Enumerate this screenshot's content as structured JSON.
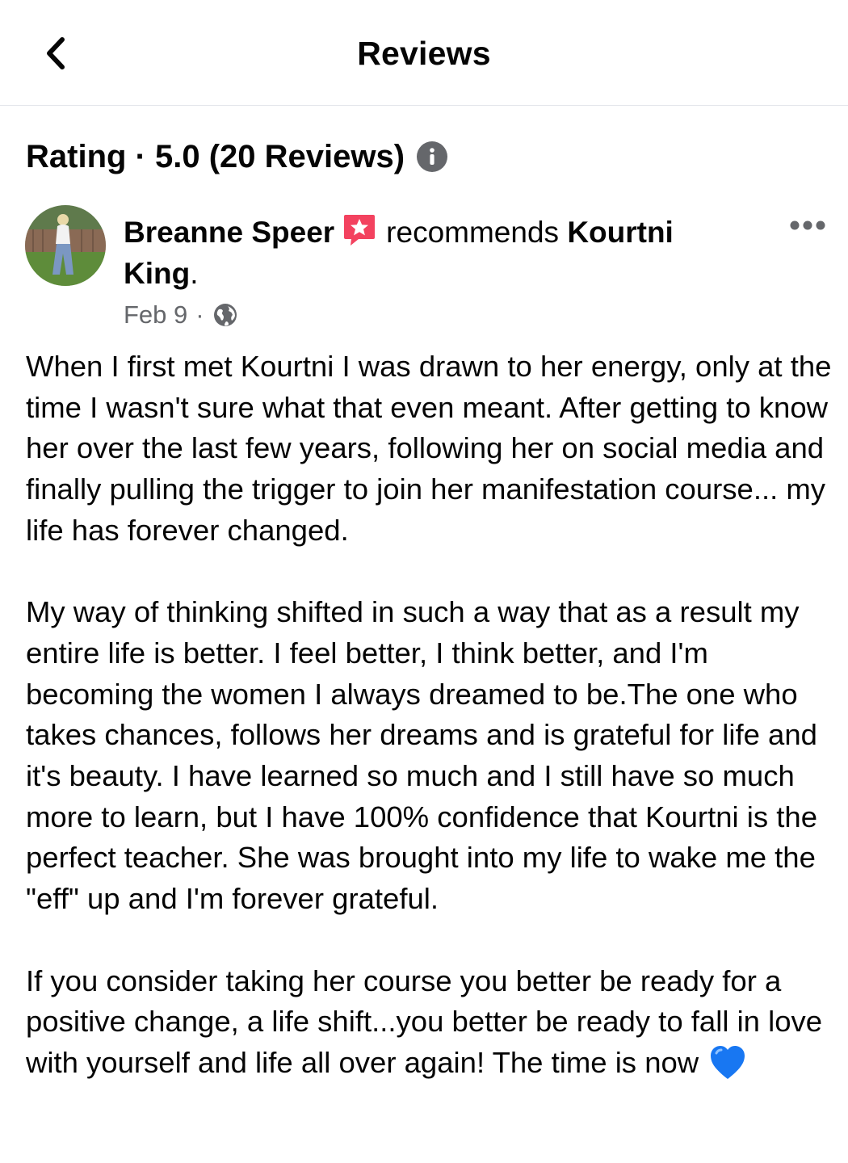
{
  "header": {
    "title": "Reviews",
    "back_icon": "chevron-left-icon"
  },
  "rating": {
    "text": "Rating · 5.0 (20 Reviews)",
    "info_icon": "info-icon"
  },
  "review": {
    "author": "Breanne Speer",
    "badge_icon": "recommend-star-icon",
    "verb": "recommends",
    "page_name": "Kourtni King",
    "period": ".",
    "date": "Feb 9",
    "meta_separator": "·",
    "privacy_icon": "globe-icon",
    "more_icon": "more-horizontal-icon",
    "paragraphs": [
      "When I first met Kourtni I was drawn to her energy, only at the time I wasn't sure what that even meant. After getting to know her over the last few years, following her on social media and finally pulling the trigger to join her manifestation course... my life has forever changed.",
      "My way of thinking shifted in such a way that as a result my entire life is better. I feel better, I think better, and I'm becoming the women I always dreamed to be.The one who takes chances, follows her dreams and is grateful for life and it's beauty. I have learned so much and I still have so much more to learn, but I have 100% confidence that Kourtni is the perfect teacher. She was brought into my life to wake me the \"eff\" up and I'm forever grateful.",
      "If you consider taking her course you better be ready for a positive change, a life shift...you better be ready to fall in love with yourself and life all over again! The time is now"
    ],
    "end_emoji_icon": "blue-heart-icon"
  },
  "colors": {
    "text": "#050505",
    "secondary_text": "#65676b",
    "divider": "#e4e6eb",
    "badge": "#f3425f",
    "info": "#65676b",
    "heart": "#1877f2"
  }
}
